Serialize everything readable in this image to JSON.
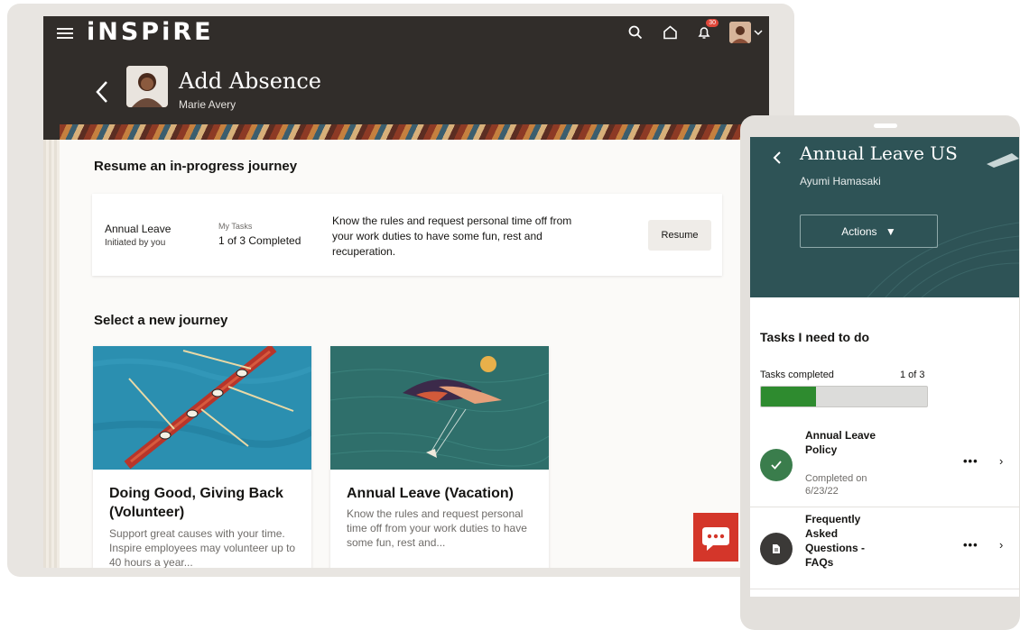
{
  "app": {
    "brand": "iNSPiRE"
  },
  "header": {
    "title": "Add Absence",
    "subtitle": "Marie Avery",
    "notification_count": "30"
  },
  "resume": {
    "heading": "Resume an in-progress journey",
    "card": {
      "name": "Annual Leave",
      "initiated": "Initiated by you",
      "tasks_label": "My Tasks",
      "tasks_value": "1 of 3 Completed",
      "description": "Know the rules and request personal time off from your work duties to have some fun, rest and recuperation.",
      "button": "Resume"
    }
  },
  "journeys": {
    "heading": "Select a new journey",
    "cards": [
      {
        "title": "Doing Good, Giving Back (Volunteer)",
        "desc": "Support great causes with your time. Inspire employees may volunteer up to 40 hours a year..."
      },
      {
        "title": "Annual Leave (Vacation)",
        "desc": "Know the rules and request personal time off from your work duties to have some fun, rest and..."
      }
    ]
  },
  "phone": {
    "title": "Annual Leave US",
    "subtitle": "Ayumi Hamasaki",
    "actions": "Actions",
    "tasks_heading": "Tasks I need to do",
    "tasks_completed_label": "Tasks completed",
    "tasks_completed_value": "1 of 3",
    "progress": 0.33,
    "items": [
      {
        "title": "Annual Leave Policy",
        "meta": "Completed on 6/23/22",
        "more": "•••",
        "chevron": "›"
      },
      {
        "title": "Frequently Asked Questions - FAQs",
        "meta": "",
        "more": "•••",
        "chevron": "›"
      }
    ]
  },
  "colors": {
    "header": "#312d2a",
    "accent_red": "#d4362a",
    "teal": "#2e5356",
    "green": "#2e8b2f"
  }
}
